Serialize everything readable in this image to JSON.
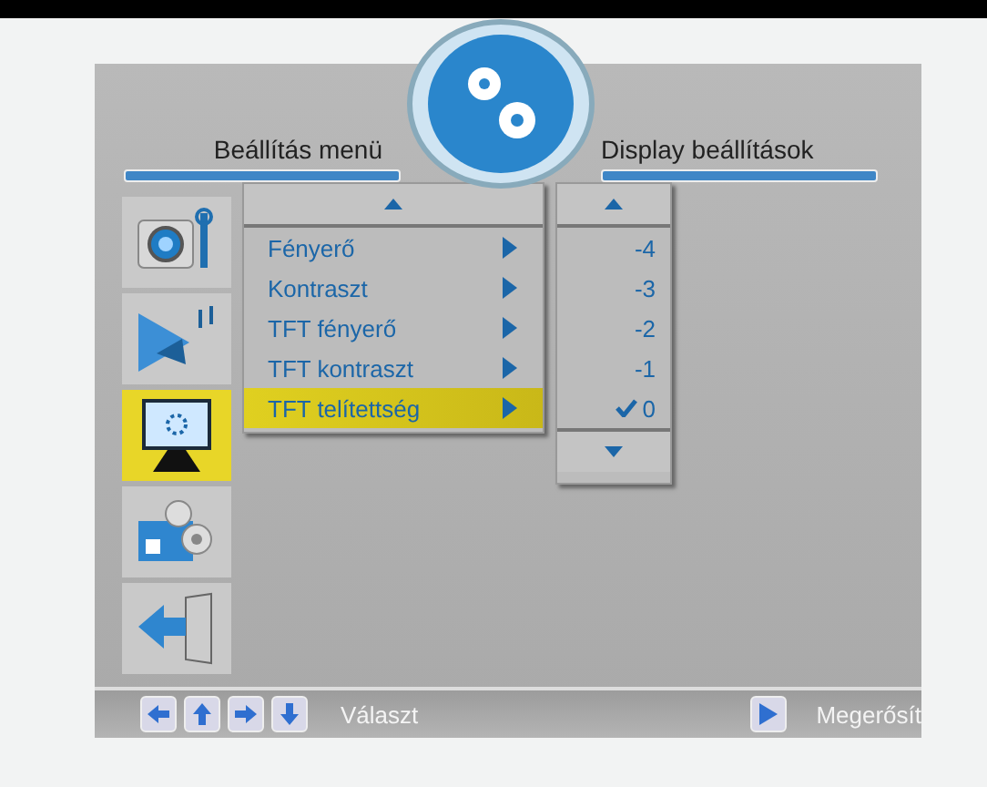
{
  "header": {
    "left_title": "Beállítás menü",
    "right_title": "Display beállítások"
  },
  "sidebar": {
    "items": [
      {
        "kind": "camera",
        "selected": false
      },
      {
        "kind": "media",
        "selected": false
      },
      {
        "kind": "display",
        "selected": true
      },
      {
        "kind": "settings",
        "selected": false
      },
      {
        "kind": "exit",
        "selected": false
      }
    ]
  },
  "menu": {
    "items": [
      {
        "label": "Fényerő",
        "selected": false
      },
      {
        "label": "Kontraszt",
        "selected": false
      },
      {
        "label": "TFT fényerő",
        "selected": false
      },
      {
        "label": "TFT kontraszt",
        "selected": false
      },
      {
        "label": "TFT telítettség",
        "selected": true
      }
    ]
  },
  "values": {
    "items": [
      {
        "label": "-4",
        "checked": false
      },
      {
        "label": "-3",
        "checked": false
      },
      {
        "label": "-2",
        "checked": false
      },
      {
        "label": "-1",
        "checked": false
      },
      {
        "label": "0",
        "checked": true
      }
    ]
  },
  "footer": {
    "select_hint": "Választ",
    "confirm_hint": "Megerősít"
  }
}
